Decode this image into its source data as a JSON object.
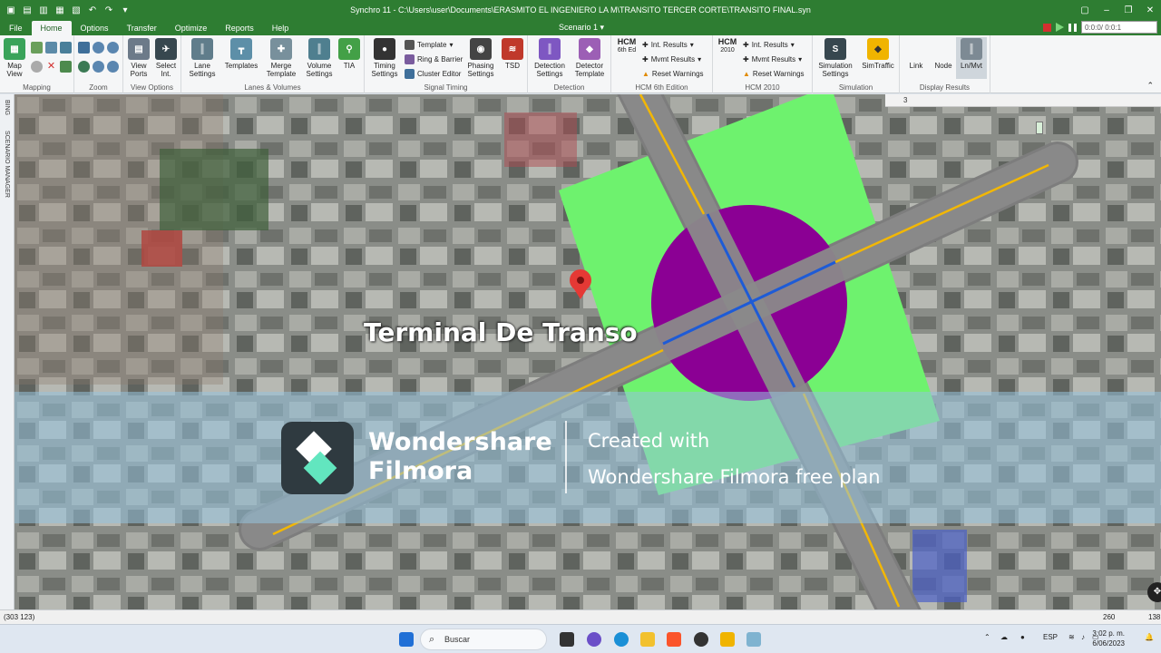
{
  "titlebar": {
    "title": "Synchro 11 - C:\\Users\\user\\Documents\\ERASMITO EL INGENIERO LA  M\\TRANSITO TERCER CORTE\\TRANSITO FINAL.syn"
  },
  "menu_tabs": [
    "File",
    "Home",
    "Options",
    "Transfer",
    "Optimize",
    "Reports",
    "Help"
  ],
  "active_tab": "Home",
  "scenario": "Scenario 1",
  "sim_time": "0:0:0/ 0:0:1",
  "ribbon": {
    "mapping": {
      "label": "Mapping",
      "buttons": [
        "Map View"
      ]
    },
    "zoom": {
      "label": "Zoom"
    },
    "view_options": {
      "label": "View Options",
      "buttons": [
        "View Ports",
        "Select Int."
      ]
    },
    "lanes_volumes": {
      "label": "Lanes & Volumes",
      "buttons": [
        "Lane Settings",
        "Templates",
        "Merge Template",
        "Volume Settings",
        "TIA"
      ]
    },
    "signal_timing": {
      "label": "Signal Timing",
      "buttons": [
        "Timing Settings",
        "Phasing Settings",
        "TSD"
      ],
      "small": [
        "Template",
        "Ring & Barrier",
        "Cluster Editor"
      ]
    },
    "detection": {
      "label": "Detection",
      "buttons": [
        "Detection Settings",
        "Detector Template"
      ]
    },
    "hcm6": {
      "label": "HCM 6th Edition",
      "badge_top": "HCM",
      "badge_bottom": "6th Ed",
      "small": [
        "Int. Results",
        "Mvmt Results",
        "Reset Warnings"
      ]
    },
    "hcm2010": {
      "label": "HCM 2010",
      "badge_top": "HCM",
      "badge_bottom": "2010",
      "small": [
        "Int. Results",
        "Mvmt Results",
        "Reset Warnings"
      ]
    },
    "simulation": {
      "label": "Simulation",
      "buttons": [
        "Simulation Settings",
        "SimTraffic"
      ]
    },
    "display_results": {
      "label": "Display Results",
      "buttons": [
        "Link",
        "Node",
        "Ln/Mvt"
      ]
    }
  },
  "sidebar": {
    "labels": [
      "BING",
      "SCENARIO MANAGER"
    ]
  },
  "map": {
    "mini_field_value": "3",
    "poi_label": "Terminal De Transo",
    "watermark": {
      "brand_line1": "Wondershare",
      "brand_line2": "Filmora",
      "text_line1": "Created with",
      "text_line2": "Wondershare Filmora free plan"
    },
    "colors": {
      "road": "#7d7d7d",
      "zone": "#6ef26e",
      "node": "#8b0094",
      "stopbar": "#1e5bd6",
      "centerline": "#f2b705",
      "pin": "#e53935"
    }
  },
  "statusbar": {
    "coords": "(303 123)",
    "x": "260",
    "y": "138"
  },
  "taskbar": {
    "search": "Buscar",
    "language": "ESP",
    "time": "3:02 p. m.",
    "date": "6/06/2023"
  }
}
